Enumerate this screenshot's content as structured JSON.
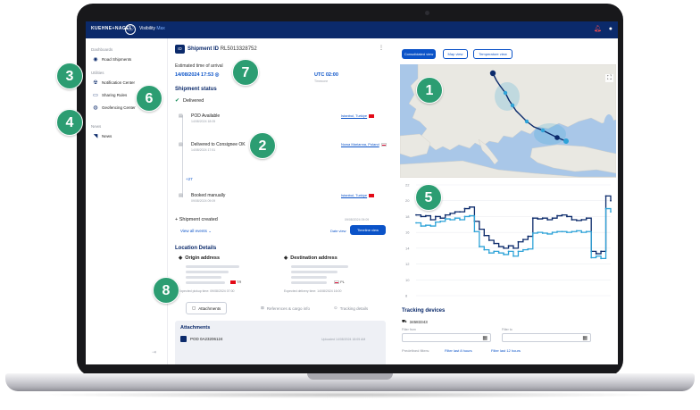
{
  "topbar": {
    "brand": "KUEHNE+NAGEL",
    "logo_mark": "ⓘ",
    "app_name": "Visibility",
    "app_suffix": "Max",
    "icons": [
      "bell-icon",
      "user-icon"
    ]
  },
  "sidebar": {
    "sections": [
      {
        "title": "Dashboards",
        "items": [
          {
            "label": "Road Shipments",
            "icon": "road-icon"
          }
        ]
      },
      {
        "title": "Utilities",
        "items": [
          {
            "label": "Notification Center",
            "icon": "notification-icon"
          },
          {
            "label": "Sharing Rules",
            "icon": "sharing-icon"
          },
          {
            "label": "Geofencing Center",
            "icon": "geofence-icon"
          }
        ]
      },
      {
        "title": "News",
        "items": [
          {
            "label": "News",
            "icon": "rss-icon"
          }
        ]
      }
    ]
  },
  "shipment": {
    "badge": "ID",
    "id_label": "Shipment ID",
    "id_value": "RL5013328752",
    "eta_title": "Estimated time of arrival",
    "eta_value": "14/08/2024 17:53",
    "utc": "UTC 02:00",
    "utc_sub": "Timezone",
    "status_title": "Shipment status",
    "status_value": "Delivered",
    "events": [
      {
        "title": "POD Available",
        "sub": "14/08/2024 18:05",
        "location": "Istanbul, Turkiye",
        "flag": "tr"
      },
      {
        "title": "Delivered to Consignee OK",
        "sub": "14/08/2024 17:51",
        "location": "Nowa Marianna, Poland",
        "flag": "pl"
      },
      {
        "title": "Booked manually",
        "sub": "09/08/2024 09:09",
        "location": "Istanbul, Turkiye",
        "flag": "tr"
      }
    ],
    "more_events": "+27",
    "created_label": "Shipment created",
    "created_date": "09/08/2024 09:09",
    "view_all": "View all events",
    "date_view": "Date view",
    "timeline_view": "Timeline view"
  },
  "location": {
    "title": "Location Details",
    "origin_title": "Origin address",
    "origin_country": "TR",
    "dest_title": "Destination address",
    "dest_country": "PL",
    "pickup": "Expected pickup time: 09/08/2024 07:00",
    "delivery": "Expected delivery time: 14/08/2024 16:00"
  },
  "tabs": [
    {
      "label": "Attachments",
      "icon": "paperclip-icon",
      "active": true
    },
    {
      "label": "References & cargo info",
      "icon": "cargo-icon",
      "active": false
    },
    {
      "label": "Tracking details",
      "icon": "tracking-icon",
      "active": false
    }
  ],
  "attachments": {
    "title": "Attachments",
    "file": "POD 0A23206124",
    "uploaded": "Uploaded 14/08/2024 18:05 AM"
  },
  "views": [
    {
      "label": "Consolidated view",
      "active": true
    },
    {
      "label": "Map view",
      "active": false
    },
    {
      "label": "Temperature view",
      "active": false
    }
  ],
  "tracking": {
    "title": "Tracking devices",
    "device": "34583343",
    "filter_from": "Filter from",
    "filter_to": "Filter to",
    "predefined": "Predefined filters:",
    "last8": "Filter last 8 hours",
    "last12": "Filter last 12 hours"
  },
  "callouts": [
    "1",
    "2",
    "3",
    "4",
    "5",
    "6",
    "7",
    "8"
  ],
  "colors": {
    "topbar": "#0b2a6b",
    "accent": "#0b53c8",
    "callout": "#2c9d72",
    "series_dark": "#0b2a6b",
    "series_light": "#2ea3d8"
  },
  "chart_data": {
    "type": "line",
    "title": "",
    "xlabel": "",
    "ylabel": "",
    "ylim": [
      8,
      22
    ],
    "yticks": [
      "22",
      "20",
      "18",
      "16",
      "14",
      "12",
      "10",
      "8"
    ],
    "grid": true,
    "series": [
      {
        "values": [
          18.2,
          18.0,
          18.1,
          17.6,
          18.0,
          17.8,
          18.2,
          18.4,
          18.6,
          18.6,
          19.0,
          19.2,
          17.4,
          16.4,
          15.6,
          15.0,
          14.6,
          14.2,
          14.0,
          14.3,
          14.0,
          14.8,
          15.1,
          15.5,
          17.8,
          17.7,
          17.8,
          17.6,
          17.8,
          18.1,
          18.2,
          18.0,
          17.6,
          17.5,
          17.6,
          17.8,
          13.6,
          13.3,
          13.6,
          20.6,
          20.0
        ]
      },
      {
        "values": [
          17.2,
          16.8,
          16.9,
          16.8,
          17.3,
          17.4,
          17.7,
          17.6,
          17.8,
          17.6,
          18.0,
          18.1,
          16.1,
          14.2,
          13.8,
          13.4,
          13.6,
          13.4,
          13.2,
          13.6,
          13.0,
          13.6,
          13.8,
          13.9,
          15.9,
          16.0,
          15.9,
          15.8,
          16.0,
          16.1,
          16.1,
          16.0,
          16.1,
          16.2,
          16.0,
          16.1,
          12.8,
          13.0,
          12.7,
          19.0,
          18.6
        ]
      }
    ]
  }
}
